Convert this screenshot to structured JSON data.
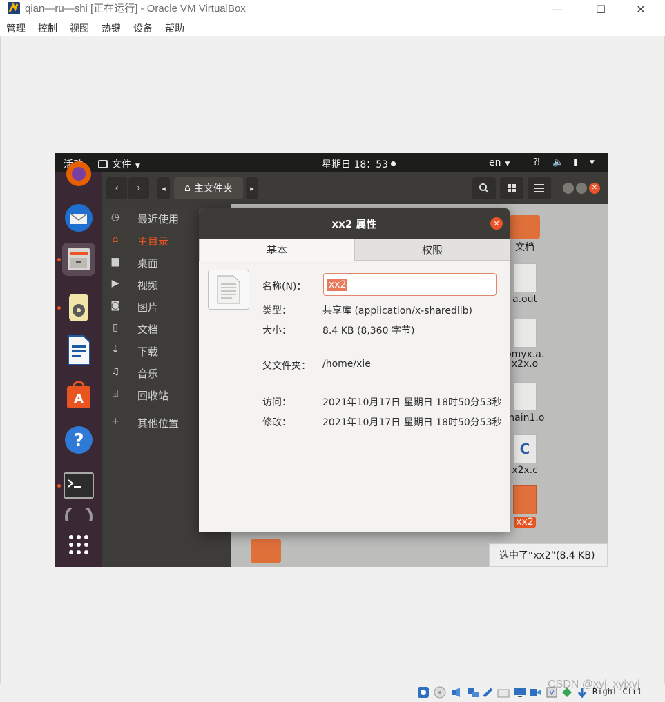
{
  "host": {
    "window_title": "qian—ru—shi [正在运行] - Oracle VM VirtualBox",
    "menu": [
      "管理",
      "控制",
      "视图",
      "热键",
      "设备",
      "帮助"
    ],
    "host_key": "Right Ctrl",
    "watermark": "CSDN @xyj_xyjxyj"
  },
  "guest": {
    "topbar": {
      "activities": "活动",
      "app_menu": "文件",
      "clock": "星期日 18：53",
      "lang": "en"
    },
    "filemanager": {
      "location": "主文件夹",
      "sidebar": [
        {
          "label": "最近使用",
          "icon": "clock-icon"
        },
        {
          "label": "主目录",
          "icon": "home-icon",
          "active": true
        },
        {
          "label": "桌面",
          "icon": "folder-icon"
        },
        {
          "label": "视频",
          "icon": "video-icon"
        },
        {
          "label": "图片",
          "icon": "camera-icon"
        },
        {
          "label": "文档",
          "icon": "document-icon"
        },
        {
          "label": "下载",
          "icon": "download-icon"
        },
        {
          "label": "音乐",
          "icon": "music-icon"
        },
        {
          "label": "回收站",
          "icon": "trash-icon"
        },
        {
          "label": "其他位置",
          "icon": "plus-icon"
        }
      ],
      "files": [
        "文档",
        "a.out",
        "bmyx.a.",
        "x2x.o",
        "main1.o",
        "x2x.c",
        "xx2"
      ],
      "status": "选中了“xx2”(8.4 KB)"
    },
    "dialog": {
      "title": "xx2 属性",
      "tabs": [
        "基本",
        "权限"
      ],
      "name_label": "名称(N)：",
      "name_value": "xx2",
      "type_label": "类型：",
      "type_value": "共享库 (application/x-sharedlib)",
      "size_label": "大小：",
      "size_value": "8.4 KB (8,360 字节)",
      "parent_label": "父文件夹：",
      "parent_value": "/home/xie",
      "access_label": "访问：",
      "access_value": "2021年10月17日 星期日 18时50分53秒",
      "modified_label": "修改：",
      "modified_value": "2021年10月17日 星期日 18时50分53秒"
    }
  },
  "colors": {
    "ubuntu_orange": "#e95420",
    "topbar": "#1d1d1b",
    "dock": "#3a2935",
    "header": "#3c3b37"
  }
}
